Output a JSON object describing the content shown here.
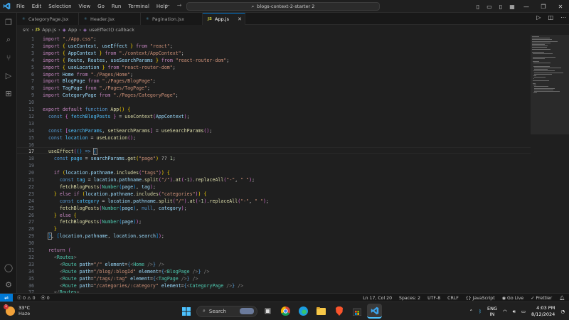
{
  "window": {
    "menu": [
      "File",
      "Edit",
      "Selection",
      "View",
      "Go",
      "Run",
      "Terminal",
      "Help"
    ],
    "search_text": "blogs-context-2-starter 2"
  },
  "tabs": [
    {
      "label": "CategoryPage.jsx",
      "icon": "react-icon",
      "active": false
    },
    {
      "label": "Header.jsx",
      "icon": "react-icon",
      "active": false
    },
    {
      "label": "Pagination.jsx",
      "icon": "react-icon",
      "active": false
    },
    {
      "label": "App.js",
      "icon": "js-icon",
      "active": true
    }
  ],
  "breadcrumb": {
    "folder": "src",
    "file": "App.js",
    "symbol1": "App",
    "symbol2": "useEffect() callback",
    "file_icon": "JS"
  },
  "code": {
    "active_line": 17,
    "lines": [
      {
        "n": "1",
        "html": "<span class='k'>import</span> <span class='s'>\"./App.css\"</span><span class='p'>;</span>"
      },
      {
        "n": "2",
        "html": "<span class='k'>import</span> <span class='b1'>{</span> <span class='v'>useContext</span><span class='p'>,</span> <span class='v'>useEffect</span> <span class='b1'>}</span> <span class='k'>from</span> <span class='s'>\"react\"</span><span class='p'>;</span>"
      },
      {
        "n": "3",
        "html": "<span class='k'>import</span> <span class='b1'>{</span> <span class='v'>AppContext</span> <span class='b1'>}</span> <span class='k'>from</span> <span class='s'>\"./context/AppContext\"</span><span class='p'>;</span>"
      },
      {
        "n": "4",
        "html": "<span class='k'>import</span> <span class='b1'>{</span> <span class='v'>Route</span><span class='p'>,</span> <span class='v'>Routes</span><span class='p'>,</span> <span class='v'>useSearchParams</span> <span class='b1'>}</span> <span class='k'>from</span> <span class='s'>\"react-router-dom\"</span><span class='p'>;</span>"
      },
      {
        "n": "5",
        "html": "<span class='k'>import</span> <span class='b1'>{</span> <span class='v'>useLocation</span> <span class='b1'>}</span> <span class='k'>from</span> <span class='s'>\"react-router-dom\"</span><span class='p'>;</span>"
      },
      {
        "n": "6",
        "html": "<span class='k'>import</span> <span class='v'>Home</span> <span class='k'>from</span> <span class='s'>\"./Pages/Home\"</span><span class='p'>;</span>"
      },
      {
        "n": "7",
        "html": "<span class='k'>import</span> <span class='v'>BlogPage</span> <span class='k'>from</span> <span class='s'>\"./Pages/BlogPage\"</span><span class='p'>;</span>"
      },
      {
        "n": "8",
        "html": "<span class='k'>import</span> <span class='v'>TagPage</span> <span class='k'>from</span> <span class='s'>\"./Pages/TagPage\"</span><span class='p'>;</span>"
      },
      {
        "n": "9",
        "html": "<span class='k'>import</span> <span class='v'>CategoryPage</span> <span class='k'>from</span> <span class='s'>\"./Pages/CategoryPage\"</span><span class='p'>;</span>"
      },
      {
        "n": "10",
        "html": ""
      },
      {
        "n": "11",
        "html": "<span class='k'>export</span> <span class='k'>default</span> <span class='kw'>function</span> <span class='f'>App</span><span class='b1'>()</span> <span class='b1'>{</span>"
      },
      {
        "n": "12",
        "html": "  <span class='kw'>const</span> <span class='b2'>{</span> <span class='c'>fetchBlogPosts</span> <span class='b2'>}</span> <span class='p'>=</span> <span class='f'>useContext</span><span class='b2'>(</span><span class='v'>AppContext</span><span class='b2'>)</span><span class='p'>;</span>"
      },
      {
        "n": "13",
        "html": ""
      },
      {
        "n": "14",
        "html": "  <span class='kw'>const</span> <span class='b2'>[</span><span class='c'>searchParams</span><span class='p'>,</span> <span class='f'>setSearchParams</span><span class='b2'>]</span> <span class='p'>=</span> <span class='f'>useSearchParams</span><span class='b2'>()</span><span class='p'>;</span>"
      },
      {
        "n": "15",
        "html": "  <span class='kw'>const</span> <span class='c'>location</span> <span class='p'>=</span> <span class='f'>useLocation</span><span class='b2'>()</span><span class='p'>;</span>"
      },
      {
        "n": "16",
        "html": ""
      },
      {
        "n": "17",
        "html": "  <span class='f'>useEffect</span><span class='b2'>(</span><span class='b3'>()</span> <span class='kw'>=&gt;</span> <span class='b3' style='outline:1px solid #888'>{</span>"
      },
      {
        "n": "18",
        "html": "    <span class='kw'>const</span> <span class='c'>page</span> <span class='p'>=</span> <span class='v'>searchParams</span><span class='p'>.</span><span class='f'>get</span><span class='b1'>(</span><span class='s'>\"page\"</span><span class='b1'>)</span> <span class='p'>??</span> <span class='n'>1</span><span class='p'>;</span>"
      },
      {
        "n": "19",
        "html": ""
      },
      {
        "n": "20",
        "html": "    <span class='k'>if</span> <span class='b1'>(</span><span class='v'>location</span><span class='p'>.</span><span class='v'>pathname</span><span class='p'>.</span><span class='f'>includes</span><span class='b2'>(</span><span class='s'>\"tags\"</span><span class='b2'>)</span><span class='b1'>)</span> <span class='b1'>{</span>"
      },
      {
        "n": "21",
        "html": "      <span class='kw'>const</span> <span class='c'>tag</span> <span class='p'>=</span> <span class='v'>location</span><span class='p'>.</span><span class='v'>pathname</span><span class='p'>.</span><span class='f'>split</span><span class='b2'>(</span><span class='s'>\"/\"</span><span class='b2'>)</span><span class='p'>.</span><span class='f'>at</span><span class='b2'>(</span><span class='p'>-</span><span class='n'>1</span><span class='b2'>)</span><span class='p'>.</span><span class='f'>replaceAll</span><span class='b2'>(</span><span class='s'>\"-\"</span><span class='p'>,</span> <span class='s'>\" \"</span><span class='b2'>)</span><span class='p'>;</span>"
      },
      {
        "n": "22",
        "html": "      <span class='f'>fetchBlogPosts</span><span class='b2'>(</span><span class='t'>Number</span><span class='b3'>(</span><span class='v'>page</span><span class='b3'>)</span><span class='p'>,</span> <span class='v'>tag</span><span class='b2'>)</span><span class='p'>;</span>"
      },
      {
        "n": "23",
        "html": "    <span class='b1'>}</span> <span class='k'>else</span> <span class='k'>if</span> <span class='b1'>(</span><span class='v'>location</span><span class='p'>.</span><span class='v'>pathname</span><span class='p'>.</span><span class='f'>includes</span><span class='b2'>(</span><span class='s'>\"categories\"</span><span class='b2'>)</span><span class='b1'>)</span> <span class='b1'>{</span>"
      },
      {
        "n": "24",
        "html": "      <span class='kw'>const</span> <span class='c'>category</span> <span class='p'>=</span> <span class='v'>location</span><span class='p'>.</span><span class='v'>pathname</span><span class='p'>.</span><span class='f'>split</span><span class='b2'>(</span><span class='s'>\"/\"</span><span class='b2'>)</span><span class='p'>.</span><span class='f'>at</span><span class='b2'>(</span><span class='p'>-</span><span class='n'>1</span><span class='b2'>)</span><span class='p'>.</span><span class='f'>replaceAll</span><span class='b2'>(</span><span class='s'>\"-\"</span><span class='p'>,</span> <span class='s'>\" \"</span><span class='b2'>)</span><span class='p'>;</span>"
      },
      {
        "n": "25",
        "html": "      <span class='f'>fetchBlogPosts</span><span class='b2'>(</span><span class='t'>Number</span><span class='b3'>(</span><span class='v'>page</span><span class='b3'>)</span><span class='p'>,</span> <span class='kw'>null</span><span class='p'>,</span> <span class='v'>category</span><span class='b2'>)</span><span class='p'>;</span>"
      },
      {
        "n": "26",
        "html": "    <span class='b1'>}</span> <span class='k'>else</span> <span class='b1'>{</span>"
      },
      {
        "n": "27",
        "html": "      <span class='f'>fetchBlogPosts</span><span class='b2'>(</span><span class='t'>Number</span><span class='b3'>(</span><span class='v'>page</span><span class='b3'>)</span><span class='b2'>)</span><span class='p'>;</span>"
      },
      {
        "n": "28",
        "html": "    <span class='b1'>}</span>"
      },
      {
        "n": "29",
        "html": "  <span class='b3' style='outline:1px solid #888'>}</span><span class='p'>,</span> <span class='b3'>[</span><span class='v'>location</span><span class='p'>.</span><span class='v'>pathname</span><span class='p'>,</span> <span class='v'>location</span><span class='p'>.</span><span class='v'>search</span><span class='b3'>]</span><span class='b2'>)</span><span class='p'>;</span>"
      },
      {
        "n": "30",
        "html": ""
      },
      {
        "n": "31",
        "html": "  <span class='k'>return</span> <span class='b2'>(</span>"
      },
      {
        "n": "32",
        "html": "    <span class='tagb'>&lt;</span><span class='t'>Routes</span><span class='tagb'>&gt;</span>"
      },
      {
        "n": "33",
        "html": "      <span class='tagb'>&lt;</span><span class='t'>Route</span> <span class='v'>path</span><span class='p'>=</span><span class='s'>\"/\"</span> <span class='v'>element</span><span class='p'>=</span><span class='kw'>{</span><span class='tagb'>&lt;</span><span class='t'>Home</span> <span class='tagb'>/&gt;</span><span class='kw'>}</span> <span class='tagb'>/&gt;</span>"
      },
      {
        "n": "34",
        "html": "      <span class='tagb'>&lt;</span><span class='t'>Route</span> <span class='v'>path</span><span class='p'>=</span><span class='s'>\"/blog/:blogId\"</span> <span class='v'>element</span><span class='p'>=</span><span class='kw'>{</span><span class='tagb'>&lt;</span><span class='t'>BlogPage</span> <span class='tagb'>/&gt;</span><span class='kw'>}</span> <span class='tagb'>/&gt;</span>"
      },
      {
        "n": "35",
        "html": "      <span class='tagb'>&lt;</span><span class='t'>Route</span> <span class='v'>path</span><span class='p'>=</span><span class='s'>\"/tags/:tag\"</span> <span class='v'>element</span><span class='p'>=</span><span class='kw'>{</span><span class='tagb'>&lt;</span><span class='t'>TagPage</span> <span class='tagb'>/&gt;</span><span class='kw'>}</span> <span class='tagb'>/&gt;</span>"
      },
      {
        "n": "36",
        "html": "      <span class='tagb'>&lt;</span><span class='t'>Route</span> <span class='v'>path</span><span class='p'>=</span><span class='s'>\"/categories/:category\"</span> <span class='v'>element</span><span class='p'>=</span><span class='kw'>{</span><span class='tagb'>&lt;</span><span class='t'>CategoryPage</span> <span class='tagb'>/&gt;</span><span class='kw'>}</span> <span class='tagb'>/&gt;</span>"
      },
      {
        "n": "37",
        "html": "    <span class='tagb'>&lt;/</span><span class='t'>Routes</span><span class='tagb'>&gt;</span>"
      }
    ]
  },
  "status": {
    "errors": "0",
    "warnings": "0",
    "ports": "0",
    "position": "Ln 17, Col 20",
    "spaces": "Spaces: 2",
    "encoding": "UTF-8",
    "eol": "CRLF",
    "language": "{} JavaScript",
    "golive": "Go Live",
    "prettier": "Prettier"
  },
  "taskbar": {
    "weather_temp": "33°C",
    "weather_desc": "Haze",
    "weather_badge": "1",
    "search_placeholder": "Search",
    "lang_top": "ENG",
    "lang_bottom": "IN",
    "time": "4:03 PM",
    "date": "8/12/2024"
  },
  "colors": {
    "accent": "#0078d4",
    "editor_bg": "#1f1f1f",
    "chrome_bg": "#181818"
  }
}
